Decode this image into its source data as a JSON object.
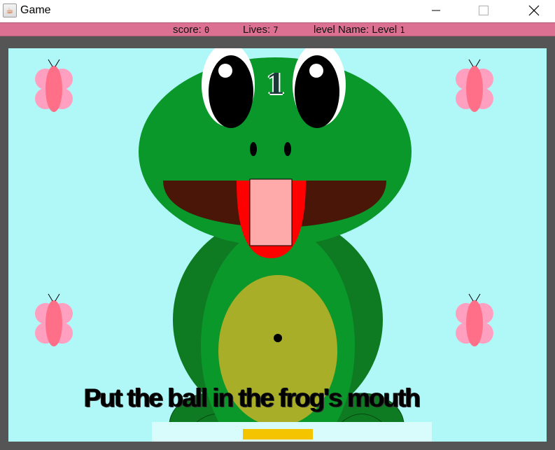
{
  "window": {
    "title": "Game",
    "app_icon": "java-cup-icon",
    "controls": {
      "minimize": "minimize-icon",
      "maximize": "maximize-icon",
      "close": "close-icon"
    }
  },
  "status": {
    "score_label": "score:",
    "score_value": "0",
    "lives_label": "Lives:",
    "lives_value": "7",
    "level_label": "level Name:",
    "level_value": "Level",
    "level_number": "1"
  },
  "game": {
    "level_digit": "1",
    "instruction": "Put the ball in the frog's mouth",
    "colors": {
      "background": "#b0f8f8",
      "status_bar": "#db7093",
      "frog_green": "#0b982b",
      "frog_dark_green": "#0e7a22",
      "belly": "#a8ae28",
      "mouth": "#4a1608",
      "tongue": "#ff0000",
      "target_block": "#ffaaaa",
      "paddle": "#f5c400",
      "butterfly_wing": "#ffa0c0",
      "butterfly_body": "#ff7088"
    },
    "decorations": [
      "butterfly-icon",
      "butterfly-icon",
      "butterfly-icon",
      "butterfly-icon"
    ]
  }
}
